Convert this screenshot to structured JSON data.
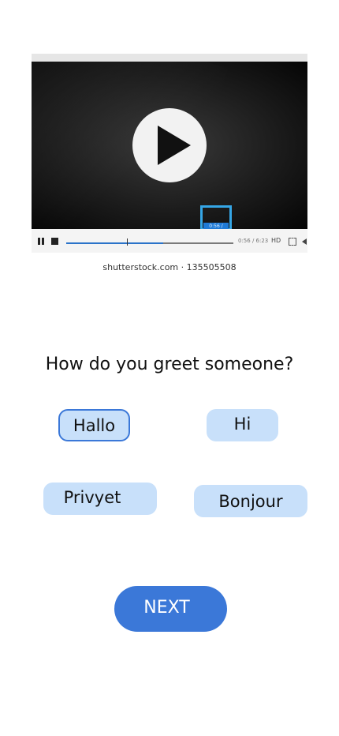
{
  "video": {
    "tooltip_time": "0:56 / 6:23",
    "time_display": "0:56 / 6:23",
    "quality_label": "HD",
    "progress": 0.58,
    "watermark": "shutterstock.com · 135505508"
  },
  "quiz": {
    "question": "How do you greet someone?",
    "options": [
      {
        "label": "Hallo",
        "selected": true
      },
      {
        "label": "Hi",
        "selected": false
      },
      {
        "label": "Privyet",
        "selected": false
      },
      {
        "label": "Bonjour",
        "selected": false
      }
    ],
    "next_label": "NEXT"
  },
  "colors": {
    "accent": "#3b78d8",
    "option_bg": "#c8e0fa",
    "video_progress": "#2a73c9"
  },
  "icons": {
    "play": "play-icon",
    "pause": "pause-icon",
    "stop": "stop-icon",
    "fullscreen": "fullscreen-icon",
    "volume": "volume-icon"
  }
}
